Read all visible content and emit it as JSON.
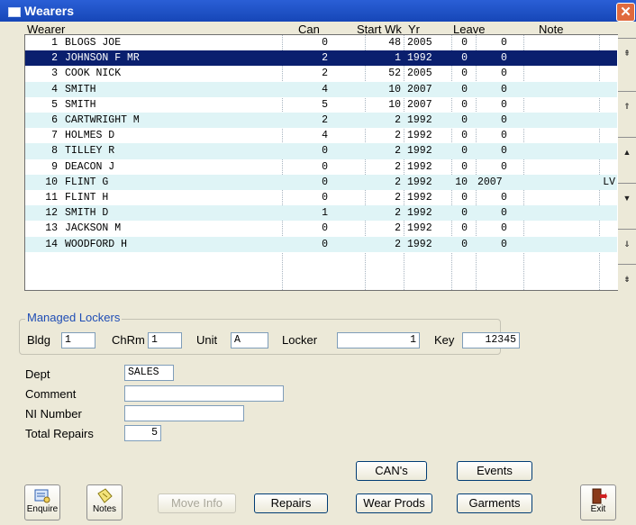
{
  "window": {
    "title": "Wearers",
    "close": "✕"
  },
  "grid": {
    "headers": {
      "wearer": "Wearer",
      "can": "Can",
      "start_wk": "Start Wk",
      "yr": "Yr",
      "leave": "Leave",
      "note": "Note"
    },
    "rows": [
      {
        "num": "1",
        "name": "BLOGS JOE",
        "can": "0",
        "wk": "48",
        "yr": "2005",
        "leave1": "0",
        "leave2": "0",
        "note": ""
      },
      {
        "num": "2",
        "name": "JOHNSON F MR",
        "can": "2",
        "wk": "1",
        "yr": "1992",
        "leave1": "0",
        "leave2": "0",
        "note": ""
      },
      {
        "num": "3",
        "name": "COOK NICK",
        "can": "2",
        "wk": "52",
        "yr": "2005",
        "leave1": "0",
        "leave2": "0",
        "note": ""
      },
      {
        "num": "4",
        "name": "SMITH",
        "can": "4",
        "wk": "10",
        "yr": "2007",
        "leave1": "0",
        "leave2": "0",
        "note": ""
      },
      {
        "num": "5",
        "name": "SMITH",
        "can": "5",
        "wk": "10",
        "yr": "2007",
        "leave1": "0",
        "leave2": "0",
        "note": ""
      },
      {
        "num": "6",
        "name": "CARTWRIGHT M",
        "can": "2",
        "wk": "2",
        "yr": "1992",
        "leave1": "0",
        "leave2": "0",
        "note": ""
      },
      {
        "num": "7",
        "name": "HOLMES D",
        "can": "4",
        "wk": "2",
        "yr": "1992",
        "leave1": "0",
        "leave2": "0",
        "note": ""
      },
      {
        "num": "8",
        "name": "TILLEY R",
        "can": "0",
        "wk": "2",
        "yr": "1992",
        "leave1": "0",
        "leave2": "0",
        "note": ""
      },
      {
        "num": "9",
        "name": "DEACON J",
        "can": "0",
        "wk": "2",
        "yr": "1992",
        "leave1": "0",
        "leave2": "0",
        "note": ""
      },
      {
        "num": "10",
        "name": "FLINT G",
        "can": "0",
        "wk": "2",
        "yr": "1992",
        "leave1": "10",
        "leave2": "2007",
        "note": "LV"
      },
      {
        "num": "11",
        "name": "FLINT H",
        "can": "0",
        "wk": "2",
        "yr": "1992",
        "leave1": "0",
        "leave2": "0",
        "note": ""
      },
      {
        "num": "12",
        "name": "SMITH D",
        "can": "1",
        "wk": "2",
        "yr": "1992",
        "leave1": "0",
        "leave2": "0",
        "note": ""
      },
      {
        "num": "13",
        "name": "JACKSON M",
        "can": "0",
        "wk": "2",
        "yr": "1992",
        "leave1": "0",
        "leave2": "0",
        "note": ""
      },
      {
        "num": "14",
        "name": "WOODFORD H",
        "can": "0",
        "wk": "2",
        "yr": "1992",
        "leave1": "0",
        "leave2": "0",
        "note": ""
      }
    ],
    "selected_index": 1,
    "colors": {
      "selected": "#0a1f6e",
      "alt_row": "#dff4f6"
    }
  },
  "nav_buttons": [
    "⇞",
    "⇑",
    "▲",
    "▼",
    "⇓",
    "⇟"
  ],
  "lockers": {
    "group_label": "Managed Lockers",
    "bldg_label": "Bldg",
    "bldg_value": "1",
    "chrm_label": "ChRm",
    "chrm_value": "1",
    "unit_label": "Unit",
    "unit_value": "A",
    "locker_label": "Locker",
    "locker_value": "1",
    "key_label": "Key",
    "key_value": "12345"
  },
  "details": {
    "dept_label": "Dept",
    "dept_value": "SALES",
    "comment_label": "Comment",
    "comment_value": "",
    "ni_label": "NI Number",
    "ni_value": "",
    "repairs_label": "Total Repairs",
    "repairs_value": "5"
  },
  "buttons": {
    "cans": "CAN's",
    "events": "Events",
    "move_info": "Move Info",
    "repairs": "Repairs",
    "wear_prods": "Wear Prods",
    "garments": "Garments",
    "enquire": "Enquire",
    "notes": "Notes",
    "exit": "Exit"
  }
}
